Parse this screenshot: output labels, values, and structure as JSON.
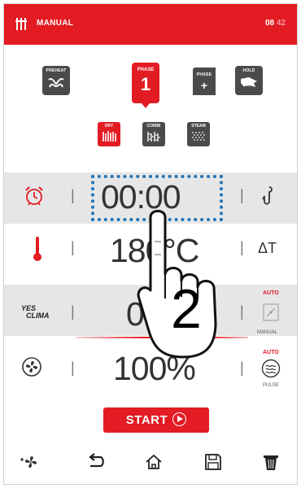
{
  "header": {
    "title": "MANUAL",
    "clock_hours": "08",
    "clock_minutes": "42"
  },
  "phase_bar": {
    "preheat_label": "PREHEAT",
    "phase_label": "PHASE",
    "phase_number": "1",
    "phase_add_label": "PHASE",
    "hold_label": "HOLD"
  },
  "modes": [
    {
      "label": "DRY",
      "active": true
    },
    {
      "label": "COMBI",
      "active": false
    },
    {
      "label": "STEAM",
      "active": false
    }
  ],
  "params": {
    "time": "00:00",
    "temperature": "180°C",
    "climate_value": "0%",
    "fan_value": "100%",
    "yes_climate_label_top": "YES",
    "yes_climate_label_bottom": "CLIMA",
    "delta_t_label": "ΔT",
    "auto_label_1": "AUTO",
    "manual_label": "MANUAL",
    "auto_label_2": "AUTO",
    "pulse_label": "PULSE"
  },
  "start_label": "START",
  "overlay_step": "2",
  "colors": {
    "brand_red": "#e31b23",
    "dark_button": "#4a4a4a",
    "highlight_blue": "#1e73b7"
  },
  "icons": {
    "timer": "alarm-clock-icon",
    "probe": "core-probe-icon",
    "thermometer": "thermometer-icon",
    "fan": "fan-icon",
    "bottom": [
      "fan-settings-icon",
      "back-icon",
      "home-icon",
      "save-icon",
      "trash-icon"
    ]
  }
}
